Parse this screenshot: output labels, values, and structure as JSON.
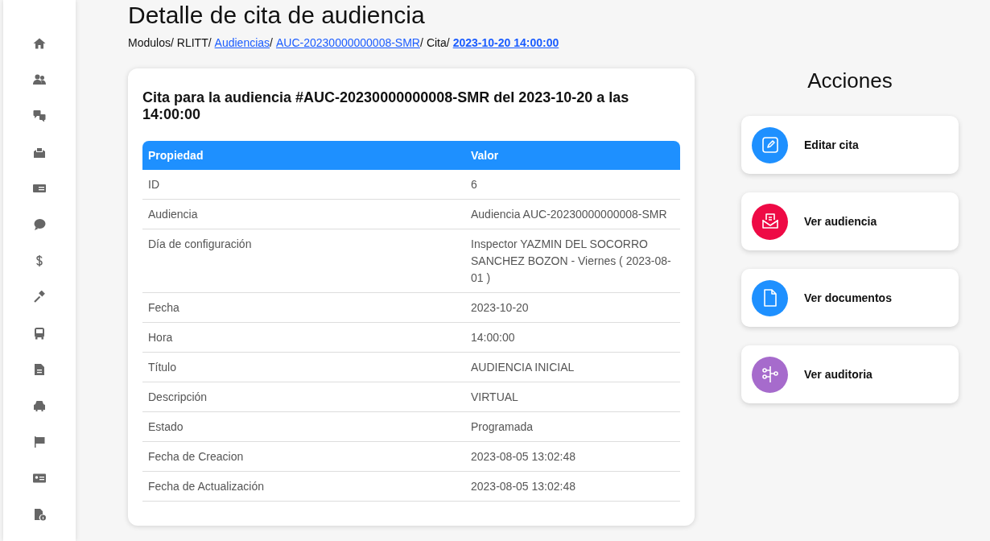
{
  "page": {
    "title": "Detalle de cita de audiencia"
  },
  "breadcrumb": [
    {
      "label": "Modulos",
      "kind": "text",
      "separator": "/"
    },
    {
      "label": "RLITT",
      "kind": "text",
      "separator": "/"
    },
    {
      "label": "Audiencias",
      "kind": "link",
      "separator": "/"
    },
    {
      "label": "AUC-20230000000008-SMR",
      "kind": "link",
      "separator": "/"
    },
    {
      "label": "Cita",
      "kind": "text",
      "separator": "/"
    },
    {
      "label": "2023-10-20 14:00:00",
      "kind": "current"
    }
  ],
  "card": {
    "heading": "Cita para la audiencia #AUC-20230000000008-SMR del 2023-10-20 a las 14:00:00",
    "table": {
      "columns": [
        "Propiedad",
        "Valor"
      ],
      "rows": [
        [
          "ID",
          "6"
        ],
        [
          "Audiencia",
          "Audiencia AUC-20230000000008-SMR"
        ],
        [
          "Día de configuración",
          "Inspector YAZMIN DEL SOCORRO SANCHEZ BOZON - Viernes ( 2023-08-01 )"
        ],
        [
          "Fecha",
          "2023-10-20"
        ],
        [
          "Hora",
          "14:00:00"
        ],
        [
          "Título",
          "AUDIENCIA INICIAL"
        ],
        [
          "Descripción",
          "VIRTUAL"
        ],
        [
          "Estado",
          "Programada"
        ],
        [
          "Fecha de Creacion",
          "2023-08-05 13:02:48"
        ],
        [
          "Fecha de Actualización",
          "2023-08-05 13:02:48"
        ]
      ]
    }
  },
  "actions": {
    "title": "Acciones",
    "items": [
      {
        "label": "Editar cita",
        "kind": "edit",
        "color": "#1e90ff"
      },
      {
        "label": "Ver audiencia",
        "kind": "envelope",
        "color": "#ee0a45"
      },
      {
        "label": "Ver documentos",
        "kind": "document",
        "color": "#1e90ff"
      },
      {
        "label": "Ver auditoria",
        "kind": "tree",
        "color": "#a66bcc"
      }
    ]
  }
}
